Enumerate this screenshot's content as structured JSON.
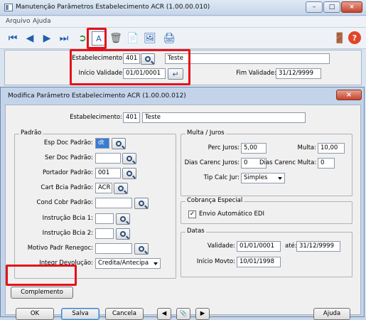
{
  "main_window": {
    "title": "Manutenção Parâmetros Estabelecimento ACR (1.00.00.010)",
    "menu": [
      "Arquivo",
      "Ajuda"
    ],
    "filter": {
      "estabelecimento_label": "Estabelecimento:",
      "estabelecimento_code": "401",
      "estabelecimento_name": "Teste",
      "inicio_label": "Início Validade:",
      "inicio_value": "01/01/0001",
      "fim_label": "Fim Validade:",
      "fim_value": "31/12/9999"
    }
  },
  "dialog": {
    "title": "Modifica Parâmetro Estabelecimento ACR (1.00.00.012)",
    "estabelecimento_label": "Estabelecimento:",
    "estabelecimento_code": "401",
    "estabelecimento_name": "Teste",
    "padrao": {
      "legend": "Padrão",
      "esp_doc_label": "Esp Doc Padrão:",
      "esp_doc_value": "dt",
      "ser_doc_label": "Ser Doc Padrão:",
      "ser_doc_value": "",
      "portador_label": "Portador Padrão:",
      "portador_value": "001",
      "cart_bcia_label": "Cart Bcia Padrão:",
      "cart_bcia_value": "ACR",
      "cond_cobr_label": "Cond Cobr Padrão:",
      "cond_cobr_value": "",
      "instr1_label": "Instrução Bcia 1:",
      "instr1_value": "",
      "instr2_label": "Instrução Bcia 2:",
      "instr2_value": "",
      "motivo_label": "Motivo Padr Renegoc:",
      "motivo_value": "",
      "integr_label": "Integr Devolução:",
      "integr_value": "Credita/Antecipa"
    },
    "multa_juros": {
      "legend": "Multa / Juros",
      "perc_juros_label": "Perc Juros:",
      "perc_juros_value": "5,00",
      "multa_label": "Multa:",
      "multa_value": "10,00",
      "dias_juros_label": "Dias Carenc Juros:",
      "dias_juros_value": "0",
      "dias_multa_label": "Dias Carenc Multa:",
      "dias_multa_value": "0",
      "tip_calc_label": "Tip Calc Jur:",
      "tip_calc_value": "Simples"
    },
    "cobranca": {
      "legend": "Cobrança Especial",
      "edi_label": "Envio Automático EDI",
      "edi_checked": true
    },
    "datas": {
      "legend": "Datas",
      "validade_label": "Validade:",
      "validade_from": "01/01/0001",
      "ate_label": "até:",
      "validade_to": "31/12/9999",
      "inicio_movto_label": "Início Movto:",
      "inicio_movto_value": "10/01/1998"
    },
    "buttons": {
      "complemento": "Complemento",
      "ok": "OK",
      "salva": "Salva",
      "cancela": "Cancela",
      "ajuda": "Ajuda"
    }
  },
  "colors": {
    "highlight": "#e3131a",
    "title_bg": "#c5d5ea",
    "panel": "#f0f0f0"
  }
}
